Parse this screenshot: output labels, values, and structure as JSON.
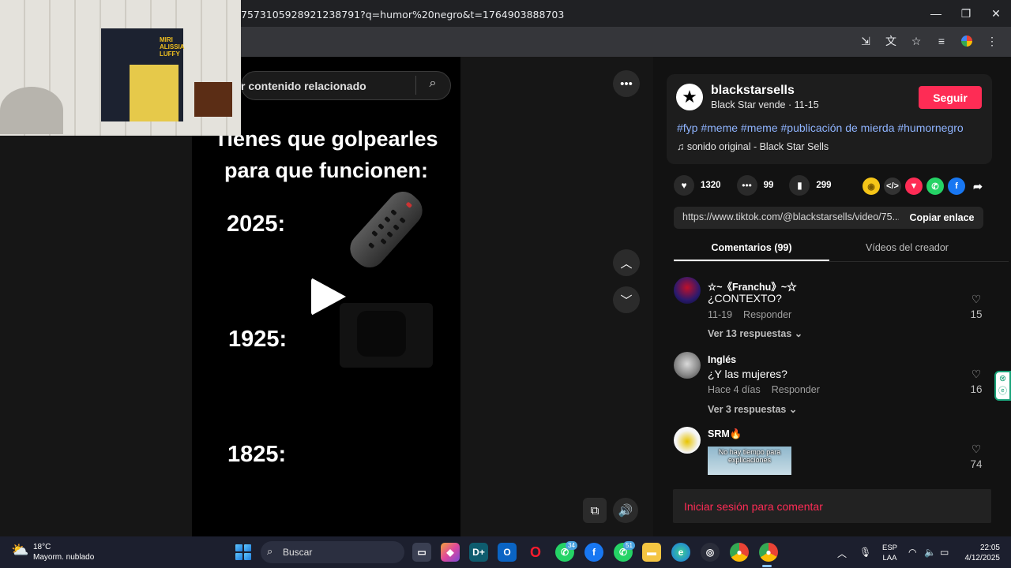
{
  "browser": {
    "url": "7573105928921238791?q=humor%20negro&t=1764903888703",
    "minimize": "—",
    "restore": "❐",
    "close": "✕"
  },
  "webcam_sign": "MIRI\nALISSIA\nLUFFY",
  "video": {
    "search_text": "r contenido relacionado",
    "title_line1": "Tienes que golpearles",
    "title_line2": "para que funcionen:",
    "years": [
      "2025:",
      "1925:",
      "1825:"
    ]
  },
  "post": {
    "username": "blackstarsells",
    "subtitle": "Black Star vende · 11-15",
    "follow_label": "Seguir",
    "hashtags": "#fyp #meme #meme #publicación de mierda #humornegro",
    "sound": "sonido original - Black Star Sells",
    "likes": "1320",
    "comments": "99",
    "saves": "299",
    "link": "https://www.tiktok.com/@blackstarsells/video/75...",
    "copy_label": "Copiar enlace"
  },
  "tabs": {
    "comments": "Comentarios (99)",
    "creator_videos": "Vídeos del creador"
  },
  "comments": [
    {
      "user": "☆~《Franchu》~☆",
      "text": "¿CONTEXTO?",
      "date": "11-19",
      "reply": "Responder",
      "view_replies": "Ver 13 respuestas ⌄",
      "likes": "15"
    },
    {
      "user": "Inglés",
      "text": "¿Y las mujeres?",
      "date": "Hace 4 días",
      "reply": "Responder",
      "view_replies": "Ver 3 respuestas ⌄",
      "likes": "16"
    },
    {
      "user": "SRM🔥",
      "gif_text": "No hay tiempo para explicaciones",
      "likes": "74"
    }
  ],
  "comment_cta": "Iniciar sesión para comentar",
  "taskbar": {
    "temp": "18°C",
    "weather": "Mayorm. nublado",
    "search": "Buscar",
    "badge_whatsapp": "34",
    "badge_whatsapp2": "51",
    "lang_line1": "ESP",
    "lang_line2": "LAA",
    "time": "22:05",
    "date": "4/12/2025"
  }
}
